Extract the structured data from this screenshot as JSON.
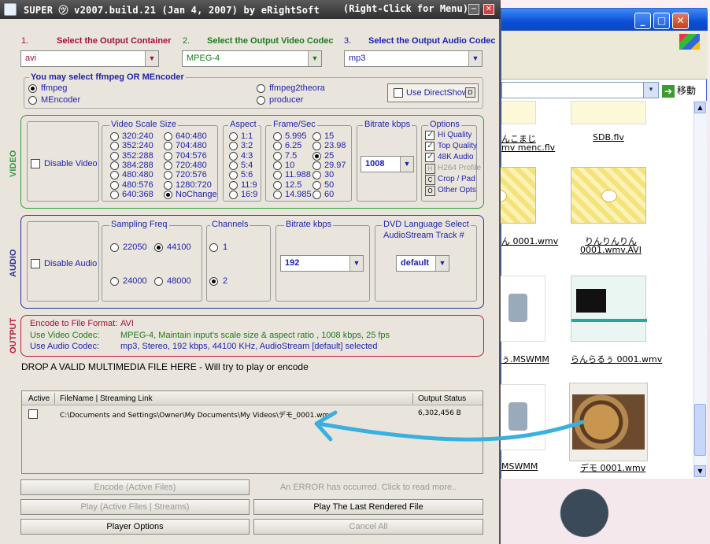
{
  "app": {
    "title": "SUPER ㋡ v2007.build.21 (Jan 4, 2007) by eRightSoft",
    "hint": "(Right-Click for Menu)",
    "minimize": "−",
    "close": "✕"
  },
  "selectors": [
    {
      "num": "1.",
      "label": "Select the Output Container",
      "value": "avi",
      "color": "#a3103a"
    },
    {
      "num": "2.",
      "label": "Select the Output Video Codec",
      "value": "MPEG-4",
      "color": "#1e7a1e"
    },
    {
      "num": "3.",
      "label": "Select the Output Audio Codec",
      "value": "mp3",
      "color": "#1c1fb0"
    }
  ],
  "engine": {
    "title": "You may select ffmpeg OR MEncoder",
    "options": [
      "ffmpeg",
      "MEncoder",
      "ffmpeg2theora",
      "producer"
    ],
    "selected": "ffmpeg",
    "directshow": "Use DirectShow",
    "directshow_icon": "D"
  },
  "video": {
    "section_label": "VIDEO",
    "disable": "Disable Video",
    "scale_title": "Video Scale Size",
    "scale_col1": [
      "320:240",
      "352:240",
      "352:288",
      "384:288",
      "480:480",
      "480:576",
      "640:368"
    ],
    "scale_col2": [
      "640:480",
      "704:480",
      "704:576",
      "720:480",
      "720:576",
      "1280:720",
      "NoChange"
    ],
    "scale_selected": "NoChange",
    "aspect_title": "Aspect",
    "aspect": [
      "1:1",
      "3:2",
      "4:3",
      "5:4",
      "5:6",
      "11:9",
      "16:9"
    ],
    "fps_title": "Frame/Sec",
    "fps_col1": [
      "5.995",
      "6.25",
      "7.5",
      "10",
      "11.988",
      "12.5",
      "14.985"
    ],
    "fps_col2": [
      "15",
      "23.98",
      "25",
      "29.97",
      "30",
      "50",
      "60"
    ],
    "fps_selected": "25",
    "bitrate_title": "Bitrate  kbps",
    "bitrate": "1008",
    "options_title": "Options",
    "options": [
      {
        "label": "Hi Quality",
        "state": "checked",
        "icon": ""
      },
      {
        "label": "Top Quality",
        "state": "checked",
        "icon": ""
      },
      {
        "label": "48K Audio",
        "state": "checked",
        "icon": ""
      },
      {
        "label": "H264 Profile",
        "state": "disabled",
        "icon": "H"
      },
      {
        "label": "Crop / Pad",
        "state": "button",
        "icon": "C"
      },
      {
        "label": "Other Opts",
        "state": "button",
        "icon": "O"
      }
    ]
  },
  "audio": {
    "section_label": "AUDIO",
    "disable": "Disable Audio",
    "freq_title": "Sampling Freq",
    "freqs": [
      "22050",
      "44100",
      "24000",
      "48000"
    ],
    "freq_selected": "44100",
    "channels_title": "Channels",
    "channels": [
      "1",
      "2"
    ],
    "channel_selected": "2",
    "bitrate_title": "Bitrate  kbps",
    "bitrate": "192",
    "dvd_title_1": "DVD Language Select",
    "dvd_title_2": "AudioStream  Track #",
    "dvd_value": "default"
  },
  "output": {
    "section_label": "OUTPUT",
    "rows": [
      {
        "label": "Encode to File Format:",
        "value": "AVI"
      },
      {
        "label": "Use Video Codec:",
        "value": "MPEG-4,  Maintain input's scale size & aspect ratio ,  1008 kbps,  25 fps"
      },
      {
        "label": "Use Audio Codec:",
        "value": "mp3,  Stereo,  192 kbps,  44100 KHz,  AudioStream [default] selected"
      }
    ]
  },
  "drop_text": "DROP A VALID MULTIMEDIA FILE HERE - Will try to play or encode",
  "table": {
    "col_active": "Active",
    "col_file": "FileName  |  Streaming Link",
    "col_status": "Output Status",
    "rows": [
      {
        "file": "C:\\Documents and Settings\\Owner\\My Documents\\My Videos\\デモ_0001.wmv",
        "status": "6,302,456 B",
        "active": false
      }
    ]
  },
  "buttons": {
    "encode": "Encode (Active Files)",
    "error": "An ERROR has occurred. Click to read more..",
    "play": "Play (Active Files | Streams)",
    "play_last": "Play The Last Rendered File",
    "player_options": "Player Options",
    "cancel": "Cancel All"
  },
  "explorer": {
    "go": "移動",
    "addr_dd": "▾",
    "files": [
      {
        "name": "んこまじ",
        "line2": "mv menc.flv"
      },
      {
        "name": "SDB.flv"
      },
      {
        "name": "ん 0001.wmv"
      },
      {
        "name": "りんりんりん",
        "line2": "0001.wmv.AVI"
      },
      {
        "name": "ぅ.MSWMM"
      },
      {
        "name": "らんらるぅ 0001.wmv"
      },
      {
        "name": "MSWMM"
      },
      {
        "name": "デモ 0001.wmv"
      }
    ]
  },
  "colors": {
    "video": "#2e9a3a",
    "audio": "#27309b",
    "output": "#c0183c",
    "annotation": "#3ab0e0"
  }
}
